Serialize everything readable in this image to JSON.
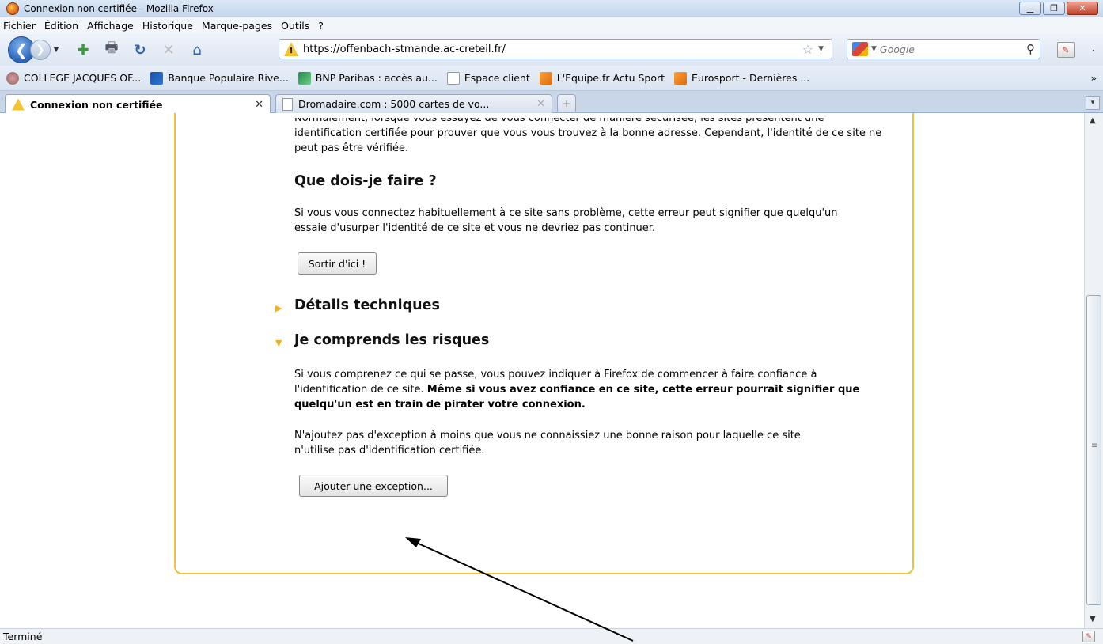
{
  "window": {
    "title": "Connexion non certifiée - Mozilla Firefox"
  },
  "menu": {
    "items": [
      "Fichier",
      "Édition",
      "Affichage",
      "Historique",
      "Marque-pages",
      "Outils",
      "?"
    ]
  },
  "navigation": {
    "url": "https://offenbach-stmande.ac-creteil.fr/",
    "search_placeholder": "Google"
  },
  "bookmarks": [
    {
      "label": "COLLEGE JACQUES OF...",
      "icon": "college-icon"
    },
    {
      "label": "Banque Populaire Rive...",
      "icon": "bank-icon"
    },
    {
      "label": "BNP Paribas : accès au...",
      "icon": "bnp-icon"
    },
    {
      "label": "Espace client",
      "icon": "page-icon"
    },
    {
      "label": "L'Equipe.fr Actu Sport",
      "icon": "rss-icon"
    },
    {
      "label": "Eurosport - Dernières ...",
      "icon": "rss-icon"
    }
  ],
  "tabs": [
    {
      "label": "Connexion non certifiée",
      "active": true
    },
    {
      "label": "Dromadaire.com : 5000 cartes de vo...",
      "active": false
    }
  ],
  "page": {
    "intro_cut": "Normalement, lorsque vous essayez de vous connecter de manière sécurisée, les sites présentent une",
    "intro": "identification certifiée pour prouver que vous vous trouvez à la bonne adresse. Cependant, l'identité de ce site ne peut pas être vérifiée.",
    "what_heading": "Que dois-je faire ?",
    "what_text": "Si vous vous connectez habituellement à ce site sans problème, cette erreur peut signifier que quelqu'un essaie d'usurper l'identité de ce site et vous ne devriez pas continuer.",
    "leave_button": "Sortir d'ici !",
    "details_heading": "Détails techniques",
    "risks_heading": "Je comprends les risques",
    "risks_text": "Si vous comprenez ce qui se passe, vous pouvez indiquer à Firefox de commencer à faire confiance à l'identification de ce site.",
    "risks_bold": "Même si vous avez confiance en ce site, cette erreur pourrait signifier que quelqu'un est en train de pirater votre connexion.",
    "exception_text": "N'ajoutez pas d'exception à moins que vous ne connaissiez une bonne raison pour laquelle ce site n'utilise pas d'identification certifiée.",
    "exception_button": "Ajouter une exception..."
  },
  "status": {
    "text": "Terminé"
  },
  "colors": {
    "panel_border": "#f0c13a",
    "accent": "#f0b020"
  }
}
